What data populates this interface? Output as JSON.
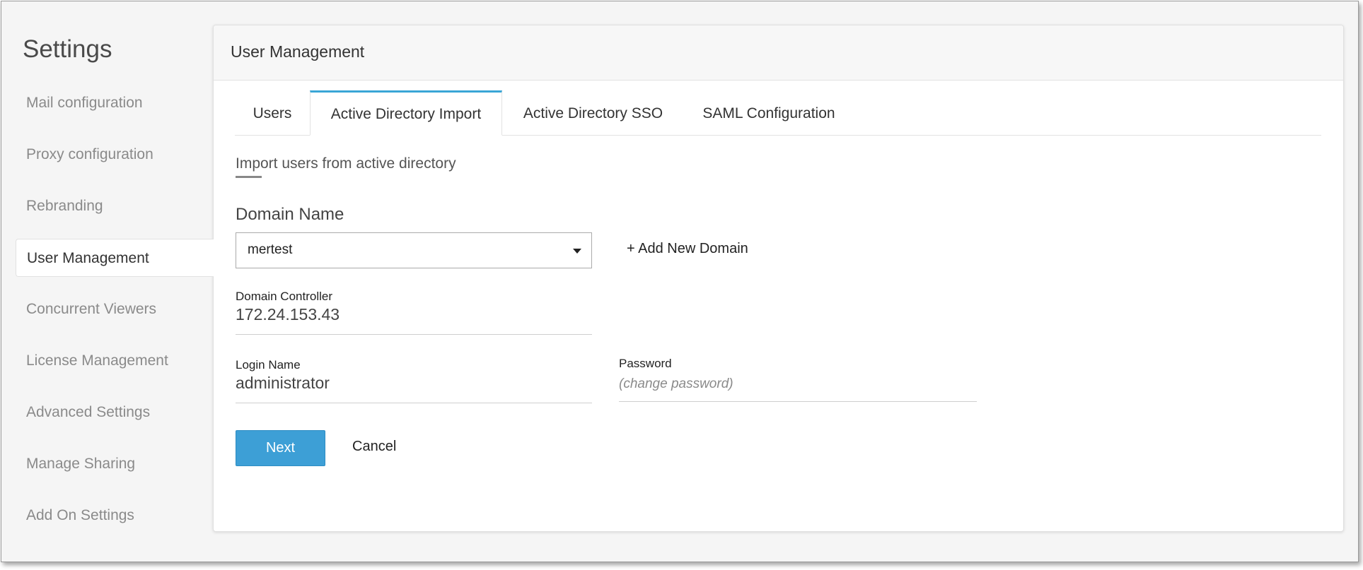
{
  "sidebar": {
    "title": "Settings",
    "items": [
      {
        "label": "Mail configuration"
      },
      {
        "label": "Proxy configuration"
      },
      {
        "label": "Rebranding"
      },
      {
        "label": "User Management"
      },
      {
        "label": "Concurrent Viewers"
      },
      {
        "label": "License Management"
      },
      {
        "label": "Advanced Settings"
      },
      {
        "label": "Manage Sharing"
      },
      {
        "label": "Add On Settings"
      }
    ],
    "active_item": "User Management"
  },
  "panel": {
    "title": "User Management",
    "tabs": [
      {
        "label": "Users"
      },
      {
        "label": "Active Directory Import"
      },
      {
        "label": "Active Directory SSO"
      },
      {
        "label": "SAML Configuration"
      }
    ],
    "active_tab": "Active Directory Import"
  },
  "form": {
    "section_heading": "Import users from active directory",
    "domain_name_label": "Domain Name",
    "domain_name_value": "mertest",
    "add_domain_label": "+ Add New Domain",
    "domain_controller_label": "Domain Controller",
    "domain_controller_value": "172.24.153.43",
    "login_name_label": "Login Name",
    "login_name_value": "administrator",
    "password_label": "Password",
    "password_placeholder": "(change password)",
    "next_label": "Next",
    "cancel_label": "Cancel"
  },
  "colors": {
    "accent": "#3aa6d6",
    "button_primary": "#3d9fd6",
    "sidebar_text": "#8a8a8a"
  },
  "icons": {
    "select_caret": "caret-down-icon"
  }
}
